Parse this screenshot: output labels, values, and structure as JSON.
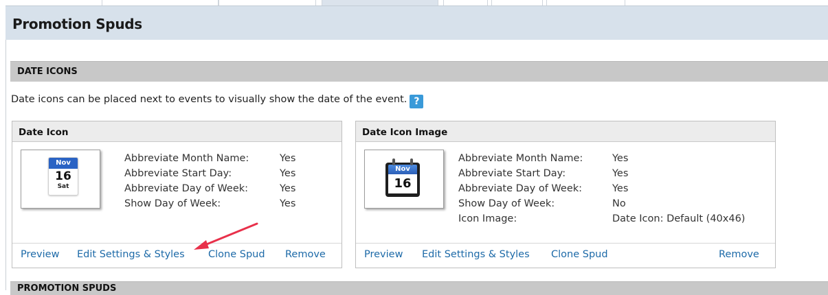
{
  "page": {
    "title": "Promotion Spuds"
  },
  "sections": {
    "date_icons": {
      "title": "DATE ICONS",
      "intro": "Date icons can be placed next to events to visually show the date of the event.",
      "help_icon": "?"
    },
    "promotion_spuds": {
      "title": "PROMOTION SPUDS"
    }
  },
  "cards": [
    {
      "title": "Date Icon",
      "icon": {
        "month": "Nov",
        "day": "16",
        "weekday": "Sat"
      },
      "properties": [
        {
          "label": "Abbreviate Month Name:",
          "value": "Yes"
        },
        {
          "label": "Abbreviate Start Day:",
          "value": "Yes"
        },
        {
          "label": "Abbreviate Day of Week:",
          "value": "Yes"
        },
        {
          "label": "Show Day of Week:",
          "value": "Yes"
        }
      ],
      "actions": {
        "preview": "Preview",
        "edit": "Edit Settings & Styles",
        "clone": "Clone Spud",
        "remove": "Remove"
      }
    },
    {
      "title": "Date Icon Image",
      "icon": {
        "month": "Nov",
        "day": "16"
      },
      "properties": [
        {
          "label": "Abbreviate Month Name:",
          "value": "Yes"
        },
        {
          "label": "Abbreviate Start Day:",
          "value": "Yes"
        },
        {
          "label": "Abbreviate Day of Week:",
          "value": "Yes"
        },
        {
          "label": "Show Day of Week:",
          "value": "No"
        },
        {
          "label": "Icon Image:",
          "value": "Date Icon: Default (40x46)"
        }
      ],
      "actions": {
        "preview": "Preview",
        "edit": "Edit Settings & Styles",
        "clone": "Clone Spud",
        "remove": "Remove"
      }
    }
  ],
  "colors": {
    "header_bg": "#d7e1eb",
    "section_bg": "#c8c8c8",
    "link": "#1d6aa8",
    "help": "#3a9ad9",
    "annotation_arrow": "#e8304a"
  }
}
